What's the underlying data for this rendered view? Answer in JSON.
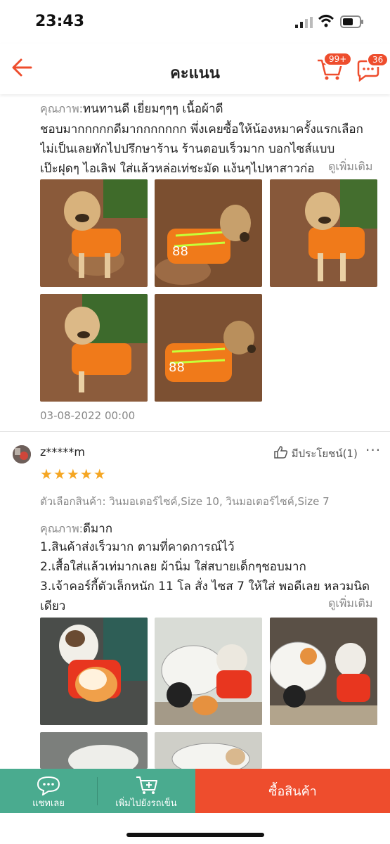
{
  "status": {
    "time": "23:43"
  },
  "header": {
    "title": "คะแนน",
    "cart_badge": "99+",
    "chat_badge": "36"
  },
  "review1": {
    "quality_label": "คุณภาพ:",
    "quality_value": "ทนทานดี เยี่ยมๆๆๆ เนื้อผ้าดี",
    "lines": [
      "ชอบมากกกกกดีมากกกกกกก พึ่งเคยซื้อให้น้องหมาครั้งแรกเลือก",
      "ไม่เป็นเลยทักไปปรึกษาร้าน ร้านตอบเร็วมาก บอกไซส์แบบ",
      "เป๊ะฝุดๆ ไอเลิฟ ใส่แล้วหล่อเท่ชะมัด แง้นๆไปหาสาวก่อ"
    ],
    "see_more": "ดูเพิ่มเติม",
    "date": "03-08-2022 00:00"
  },
  "review2": {
    "username": "z*****m",
    "helpful": "มีประโยชน์(1)",
    "more": "···",
    "stars": "★★★★★",
    "variant": "ตัวเลือกสินค้า: วินมอเตอร์ไซค์,Size 10, วินมอเตอร์ไซค์,Size 7",
    "quality_label": "คุณภาพ:",
    "quality_value": "ดีมาก",
    "lines": [
      "1.สินค้าส่งเร็วมาก ตามที่คาดการณ์ไว้",
      "2.เสื้อใส่แล้วเท่มากเลย ผ้านิ่ม ใส่สบายเด็กๆชอบมาก",
      "3.เจ้าคอร์กี้ตัวเล็กหนัก 11 โล สั่ง ไซส 7 ให้ใส่ พอดีเลย หลวมนิด",
      "เดียว"
    ],
    "see_more": "ดูเพิ่มเติม"
  },
  "bottom_bar": {
    "chat_label": "แชทเลย",
    "add_cart_label": "เพิ่มไปยังรถเข็น",
    "buy_label": "ซื้อสินค้า"
  },
  "colors": {
    "accent": "#ee4d2d",
    "green": "#4aab8f",
    "star": "#f5a623"
  }
}
